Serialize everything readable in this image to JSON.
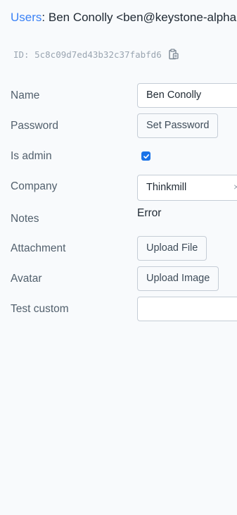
{
  "header": {
    "breadcrumb_link": "Users",
    "title": ": Ben Conolly <ben@keystone-alpha.com>"
  },
  "item": {
    "id_text": "ID: 5c8c09d7ed43b32c37fabfd6",
    "copy_icon": "clipboard-icon"
  },
  "form": {
    "name": {
      "label": "Name",
      "value": "Ben Conolly"
    },
    "password": {
      "label": "Password",
      "button": "Set Password"
    },
    "is_admin": {
      "label": "Is admin",
      "checked": true
    },
    "company": {
      "label": "Company",
      "value": "Thinkmill",
      "clear_glyph": "×"
    },
    "notes": {
      "label": "Notes",
      "value": "Error"
    },
    "attachment": {
      "label": "Attachment",
      "button": "Upload File"
    },
    "avatar": {
      "label": "Avatar",
      "button": "Upload Image"
    },
    "test_custom": {
      "label": "Test custom",
      "value": ""
    }
  },
  "colors": {
    "link": "#3b82f6",
    "checkbox": "#1a73e8",
    "background": "#f8fafc"
  }
}
